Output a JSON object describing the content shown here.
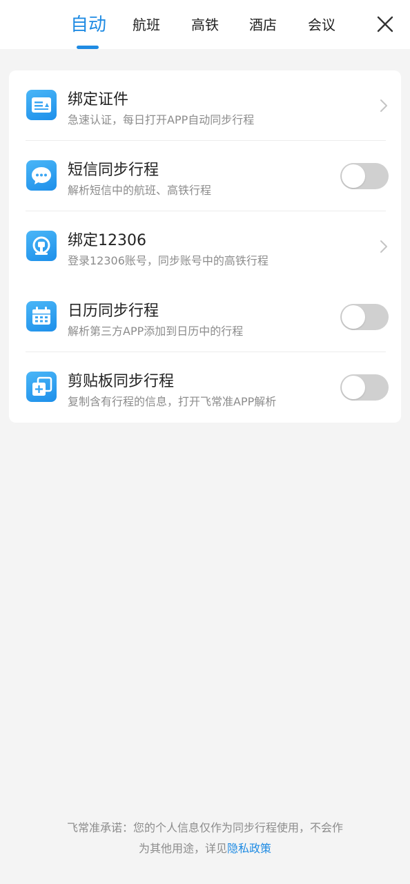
{
  "tabs": [
    {
      "label": "自动",
      "active": true
    },
    {
      "label": "航班",
      "active": false
    },
    {
      "label": "高铁",
      "active": false
    },
    {
      "label": "酒店",
      "active": false
    },
    {
      "label": "会议",
      "active": false
    }
  ],
  "colors": {
    "accent": "#1f8be3",
    "toggle_off": "#d0d0d0",
    "background": "#f4f4f4"
  },
  "items": [
    {
      "title": "绑定证件",
      "subtitle": "急速认证，每日打开APP自动同步行程",
      "icon": "id-card-icon",
      "control": "chevron"
    },
    {
      "title": "短信同步行程",
      "subtitle": "解析短信中的航班、高铁行程",
      "icon": "message-icon",
      "control": "toggle",
      "enabled": false
    },
    {
      "title": "绑定12306",
      "subtitle": "登录12306账号，同步账号中的高铁行程",
      "icon": "railway-icon",
      "control": "chevron"
    },
    {
      "title": "日历同步行程",
      "subtitle": "解析第三方APP添加到日历中的行程",
      "icon": "calendar-icon",
      "control": "toggle",
      "enabled": false
    },
    {
      "title": "剪贴板同步行程",
      "subtitle": "复制含有行程的信息，打开飞常准APP解析",
      "icon": "clipboard-icon",
      "control": "toggle",
      "enabled": false
    }
  ],
  "footer": {
    "line1": "飞常准承诺：您的个人信息仅作为同步行程使用，不会作",
    "line2_prefix": "为其他用途，详见",
    "link": "隐私政策"
  }
}
